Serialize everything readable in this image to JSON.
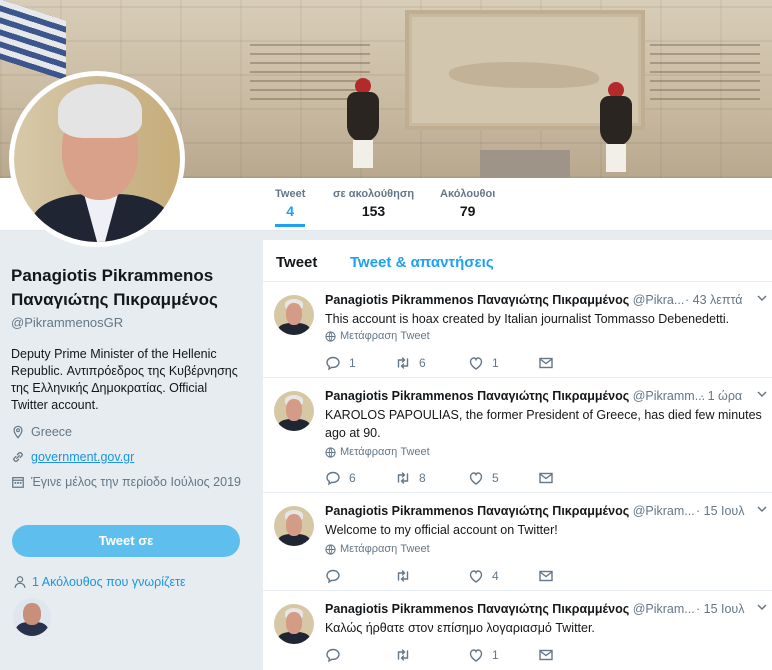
{
  "profile": {
    "name": "Panagiotis Pikrammenos Παναγιώτης Πικραμμένος",
    "handle": "@PikrammenosGR",
    "bio": "Deputy Prime Minister of the Hellenic Republic. Αντιπρόεδρος της Κυβέρνησης της Ελληνικής Δημοκρατίας. Official Twitter account.",
    "location": "Greece",
    "website": "government.gov.gr",
    "joined": "Έγινε μέλος την περίοδο Ιούλιος 2019",
    "tweet_button": "Tweet σε",
    "followers_you_know": "1 Ακόλουθος που γνωρίζετε"
  },
  "stats": [
    {
      "label": "Tweet",
      "value": "4"
    },
    {
      "label": "σε ακολούθηση",
      "value": "153"
    },
    {
      "label": "Ακόλουθοι",
      "value": "79"
    }
  ],
  "tabs": [
    "Tweet",
    "Tweet & απαντήσεις"
  ],
  "tweets": [
    {
      "name": "Panagiotis Pikrammenos Παναγιώτης Πικραμμένος",
      "handle": "@Pikra...",
      "time": "· 43 λεπτά",
      "text": "This account is hoax created by Italian journalist Tommasso Debenedetti.",
      "translate": "Μετάφραση Tweet",
      "replies": "1",
      "retweets": "6",
      "likes": "1"
    },
    {
      "name": "Panagiotis Pikrammenos Παναγιώτης Πικραμμένος",
      "handle": "@Pikramm...",
      "time": "· 1 ώρα",
      "text": "KAROLOS PAPOULIAS, the former President of Greece, has died few minutes ago at 90.",
      "translate": "Μετάφραση Tweet",
      "replies": "6",
      "retweets": "8",
      "likes": "5"
    },
    {
      "name": "Panagiotis Pikrammenos Παναγιώτης Πικραμμένος",
      "handle": "@Pikram...",
      "time": "· 15 Ιουλ",
      "text": "Welcome to my official account on Twitter!",
      "translate": "Μετάφραση Tweet",
      "replies": "",
      "retweets": "",
      "likes": "4"
    },
    {
      "name": "Panagiotis Pikrammenos Παναγιώτης Πικραμμένος",
      "handle": "@Pikram...",
      "time": "· 15 Ιουλ",
      "text": "Καλώς ήρθατε στον επίσημο λογαριασμό Twitter.",
      "translate": "",
      "replies": "",
      "retweets": "",
      "likes": "1"
    }
  ],
  "icons": {
    "reply": "reply-icon",
    "retweet": "retweet-icon",
    "like": "heart-icon",
    "dm": "envelope-icon",
    "location": "location-pin-icon",
    "link": "link-icon",
    "calendar": "calendar-icon",
    "person": "person-icon",
    "globe": "globe-icon"
  },
  "colors": {
    "accent": "#1da1f2",
    "tweet_button": "#5ebfef",
    "muted": "#657786",
    "background": "#e6ecf0"
  }
}
